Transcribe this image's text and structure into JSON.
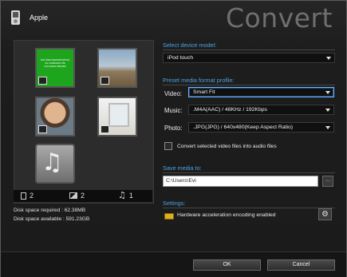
{
  "header": {
    "device_name": "Apple",
    "title": "Convert"
  },
  "media": {
    "thumb1_text": "FOR VIDEO DEMONSTRATION\nALL AUDIENCES\nTHE FOLLOWING PREVIEW",
    "counts": {
      "video": "2",
      "photo": "2",
      "music": "1"
    },
    "disk_required": "Disk space required : 62.38MB",
    "disk_available": "Disk space available : 591.23GB"
  },
  "device": {
    "label": "Select device model:",
    "value": "iPod touch"
  },
  "profile": {
    "label": "Preset media format profile:",
    "video_label": "Video:",
    "video_value": "Smart Fit",
    "music_label": "Music:",
    "music_value": ".M4A(AAC) / 48KHz / 192Kbps",
    "photo_label": "Photo:",
    "photo_value": ".JPG(JPG) / 640x480(Keep Aspect Ratio)",
    "convert_check_label": "Convert selected video files into audio files"
  },
  "save": {
    "label": "Save media to:",
    "path": "C:\\Users\\Evi",
    "browse_label": "..."
  },
  "settings": {
    "label": "Settings:",
    "hw_label": "Hardware acceleration encoding enabled"
  },
  "buttons": {
    "ok": "OK",
    "cancel": "Cancel"
  },
  "colors": {
    "accent": "#4aa3e0",
    "hw_indicator": "#d9b21c"
  },
  "icons": {
    "device": "ipod-icon",
    "settings": "gear-icon",
    "video_count": "film-icon",
    "photo_count": "photo-icon",
    "music_count": "music-note-icon"
  }
}
